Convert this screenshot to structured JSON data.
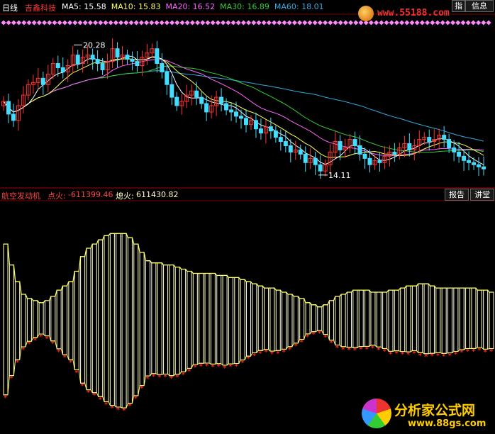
{
  "header": {
    "period": "日线",
    "stock_name": "吉鑫科技",
    "ma_items": [
      {
        "label": "MA5:",
        "value": "15.58",
        "color": "#ffffff"
      },
      {
        "label": "MA10:",
        "value": "15.83",
        "color": "#ffff55"
      },
      {
        "label": "MA20:",
        "value": "16.52",
        "color": "#ff66ff"
      },
      {
        "label": "MA30:",
        "value": "16.89",
        "color": "#33cc33"
      },
      {
        "label": "MA60:",
        "value": "18.01",
        "color": "#33aadd"
      }
    ]
  },
  "top_buttons": {
    "guide": "指",
    "info": "信息"
  },
  "indicator": {
    "name": "航空发动机",
    "ignite_label": "点火:",
    "ignite_value": "-611399.46",
    "flameout_label": "熄火:",
    "flameout_value": "611430.82"
  },
  "panel_buttons": {
    "report": "报告",
    "lecture": "讲堂"
  },
  "watermarks": {
    "top_url": "www.55188.com",
    "bottom_cn": "分析家公式网",
    "bottom_url": "www.88gs.com"
  },
  "colors": {
    "up": "#ff3333",
    "down": "#44ddff",
    "ma5": "#ffffff",
    "ma10": "#ffff55",
    "ma20": "#ff66ff",
    "ma30": "#33cc33",
    "ma60": "#33aadd",
    "bars": "#ffffcc",
    "stars": "#ff2222"
  },
  "chart_data": [
    {
      "type": "candlestick",
      "annotations": [
        {
          "label": "20.28",
          "value": 20.28
        },
        {
          "label": "14.11",
          "value": 14.11
        }
      ],
      "ylim": [
        13.6,
        21.2
      ],
      "close": [
        17.6,
        17.0,
        16.7,
        17.4,
        17.9,
        18.4,
        18.5,
        18.7,
        18.4,
        18.9,
        19.4,
        19.2,
        19.0,
        19.3,
        19.8,
        19.4,
        19.7,
        19.8,
        19.6,
        19.4,
        19.1,
        19.5,
        20.1,
        19.7,
        19.8,
        19.6,
        19.5,
        19.3,
        19.7,
        19.9,
        20.1,
        19.4,
        19.0,
        18.4,
        17.8,
        17.4,
        17.6,
        17.9,
        18.1,
        17.8,
        17.5,
        17.1,
        17.4,
        17.8,
        17.5,
        17.2,
        17.1,
        16.9,
        16.8,
        16.5,
        16.7,
        16.3,
        16.1,
        16.4,
        16.2,
        15.9,
        15.7,
        15.5,
        15.2,
        15.3,
        15.1,
        14.7,
        14.9,
        14.6,
        14.3,
        14.6,
        15.2,
        15.7,
        15.3,
        15.4,
        15.8,
        15.5,
        15.1,
        14.9,
        14.6,
        14.8,
        14.7,
        15.0,
        15.2,
        15.1,
        15.4,
        15.6,
        15.3,
        15.5,
        15.8,
        15.9,
        15.7,
        15.8,
        16.0,
        15.8,
        15.4,
        15.2,
        15.0,
        14.8,
        14.7,
        14.6,
        14.5,
        14.4
      ],
      "ma": {
        "MA5": 15.58,
        "MA10": 15.83,
        "MA20": 16.52,
        "MA30": 16.89,
        "MA60": 18.01
      }
    },
    {
      "type": "bar",
      "title": "航空发动机",
      "series": [
        {
          "name": "点火",
          "last": -611399.46
        },
        {
          "name": "熄火",
          "last": 611430.82
        }
      ],
      "ylim": [
        -611450,
        -611340
      ],
      "values": [
        -611360,
        -611370,
        -611378,
        -611384,
        -611386,
        -611387,
        -611388,
        -611387,
        -611385,
        -611382,
        -611380,
        -611378,
        -611373,
        -611366,
        -611362,
        -611360,
        -611358,
        -611356,
        -611355,
        -611355,
        -611355,
        -611357,
        -611360,
        -611364,
        -611368,
        -611369,
        -611369,
        -611370,
        -611370,
        -611371,
        -611372,
        -611373,
        -611374,
        -611374,
        -611374,
        -611374,
        -611375,
        -611375,
        -611376,
        -611376,
        -611377,
        -611378,
        -611379,
        -611380,
        -611381,
        -611381,
        -611382,
        -611383,
        -611384,
        -611385,
        -611386,
        -611388,
        -611389,
        -611390,
        -611389,
        -611387,
        -611385,
        -611384,
        -611383,
        -611382,
        -611382,
        -611382,
        -611383,
        -611383,
        -611383,
        -611382,
        -611382,
        -611381,
        -611380,
        -611380,
        -611379,
        -611379,
        -611380,
        -611381,
        -611381,
        -611381,
        -611381,
        -611381,
        -611381,
        -611381,
        -611382,
        -611382,
        -611383
      ]
    }
  ]
}
